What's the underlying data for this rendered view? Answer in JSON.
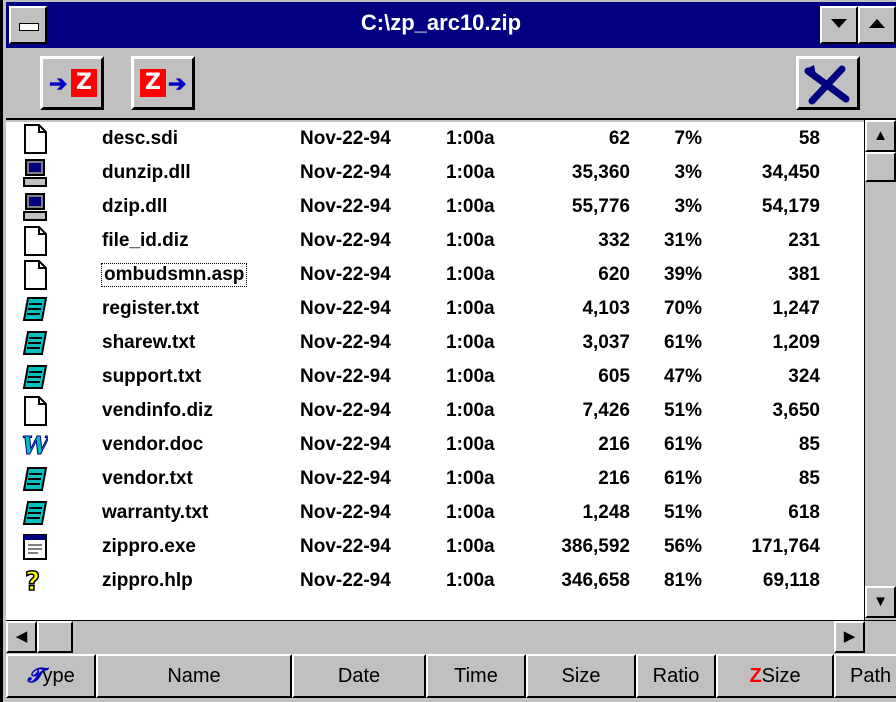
{
  "window": {
    "title": "C:\\zp_arc10.zip",
    "system_menu_icon": "minus-bar-icon",
    "minimize_icon": "triangle-down-icon",
    "maximize_icon": "triangle-up-icon"
  },
  "toolbar": {
    "buttons": [
      {
        "name": "add-to-zip",
        "icon": "arrow-into-zip-icon"
      },
      {
        "name": "extract-from-zip",
        "icon": "arrow-out-of-zip-icon"
      },
      {
        "name": "cancel",
        "icon": "cross-icon"
      }
    ],
    "colors": {
      "zip_red": "#ff0000",
      "arrow_blue": "#0000c0",
      "title_bar": "#000080"
    }
  },
  "files": [
    {
      "type": "blank-doc-icon",
      "name": "desc.sdi",
      "date": "Nov-22-94",
      "time": "1:00a",
      "size": "62",
      "ratio": "7%",
      "zsize": "58"
    },
    {
      "type": "computer-icon",
      "name": "dunzip.dll",
      "date": "Nov-22-94",
      "time": "1:00a",
      "size": "35,360",
      "ratio": "3%",
      "zsize": "34,450"
    },
    {
      "type": "computer-icon",
      "name": "dzip.dll",
      "date": "Nov-22-94",
      "time": "1:00a",
      "size": "55,776",
      "ratio": "3%",
      "zsize": "54,179"
    },
    {
      "type": "blank-doc-icon",
      "name": "file_id.diz",
      "date": "Nov-22-94",
      "time": "1:00a",
      "size": "332",
      "ratio": "31%",
      "zsize": "231"
    },
    {
      "type": "blank-doc-icon",
      "name": "ombudsmn.asp",
      "date": "Nov-22-94",
      "time": "1:00a",
      "size": "620",
      "ratio": "39%",
      "zsize": "381",
      "focused": true
    },
    {
      "type": "notepad-icon",
      "name": "register.txt",
      "date": "Nov-22-94",
      "time": "1:00a",
      "size": "4,103",
      "ratio": "70%",
      "zsize": "1,247"
    },
    {
      "type": "notepad-icon",
      "name": "sharew.txt",
      "date": "Nov-22-94",
      "time": "1:00a",
      "size": "3,037",
      "ratio": "61%",
      "zsize": "1,209"
    },
    {
      "type": "notepad-icon",
      "name": "support.txt",
      "date": "Nov-22-94",
      "time": "1:00a",
      "size": "605",
      "ratio": "47%",
      "zsize": "324"
    },
    {
      "type": "blank-doc-icon",
      "name": "vendinfo.diz",
      "date": "Nov-22-94",
      "time": "1:00a",
      "size": "7,426",
      "ratio": "51%",
      "zsize": "3,650"
    },
    {
      "type": "word-icon",
      "name": "vendor.doc",
      "date": "Nov-22-94",
      "time": "1:00a",
      "size": "216",
      "ratio": "61%",
      "zsize": "85"
    },
    {
      "type": "notepad-icon",
      "name": "vendor.txt",
      "date": "Nov-22-94",
      "time": "1:00a",
      "size": "216",
      "ratio": "61%",
      "zsize": "85"
    },
    {
      "type": "notepad-icon",
      "name": "warranty.txt",
      "date": "Nov-22-94",
      "time": "1:00a",
      "size": "1,248",
      "ratio": "51%",
      "zsize": "618"
    },
    {
      "type": "exe-window-icon",
      "name": "zippro.exe",
      "date": "Nov-22-94",
      "time": "1:00a",
      "size": "386,592",
      "ratio": "56%",
      "zsize": "171,764"
    },
    {
      "type": "help-icon",
      "name": "zippro.hlp",
      "date": "Nov-22-94",
      "time": "1:00a",
      "size": "346,658",
      "ratio": "81%",
      "zsize": "69,118"
    }
  ],
  "columns": {
    "type": "ype",
    "name": "Name",
    "date": "Date",
    "time": "Time",
    "size": "Size",
    "ratio": "Ratio",
    "zsize": "Size",
    "path": "Path"
  },
  "scrollbars": {
    "up_icon": "arrow-up-icon",
    "down_icon": "arrow-down-icon",
    "left_icon": "arrow-left-icon",
    "right_icon": "arrow-right-icon"
  }
}
